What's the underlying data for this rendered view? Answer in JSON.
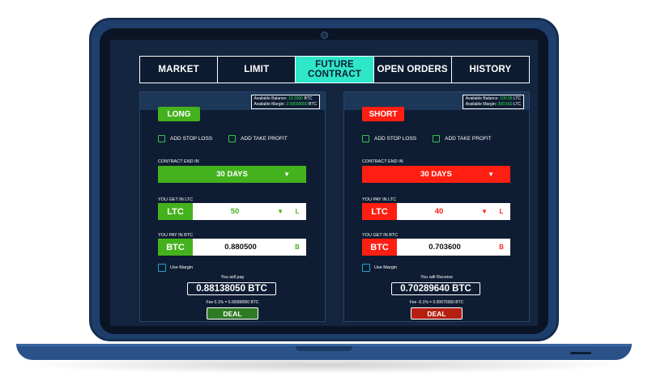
{
  "colors": {
    "long_green": "#44b21d",
    "short_red": "#ff1f12",
    "active_tab": "#2ee6c8",
    "deal_green": "#2f7a24",
    "deal_red": "#b41f12"
  },
  "tabs": [
    {
      "label": "MARKET"
    },
    {
      "label": "LIMIT"
    },
    {
      "label": "FUTURE CONTRACT"
    },
    {
      "label": "OPEN ORDERS"
    },
    {
      "label": "HISTORY"
    }
  ],
  "long": {
    "balance_label": "Available Balance:",
    "balance_value": "10.2000",
    "balance_unit": "BTC",
    "margin_label": "Available Margin:",
    "margin_value": "2.00500000",
    "margin_unit": "BTC",
    "side_label": "LONG",
    "stop_loss": "ADD STOP LOSS",
    "take_profit": "ADD TAKE PROFIT",
    "contract_label": "CONTRACT END IN",
    "contract_value": "30 DAYS",
    "get_label": "YOU GET IN LTC",
    "get_currency": "LTC",
    "get_amount": "50",
    "get_suffix": "L",
    "pay_label": "YOU PAY IN BTC",
    "pay_currency": "BTC",
    "pay_amount": "0.880500",
    "pay_suffix": "B",
    "use_margin": "Use Margin",
    "total_label": "You will pay",
    "total_value": "0.88138050 BTC",
    "fee": "Fee 0.1% = 0.00088050 BTC",
    "deal": "DEAL"
  },
  "short": {
    "balance_label": "Available Balance:",
    "balance_value": "100.56",
    "balance_unit": "LTC",
    "margin_label": "Available Margin:",
    "margin_value": "200.560",
    "margin_unit": "LTC",
    "side_label": "SHORT",
    "stop_loss": "ADD STOP LOSS",
    "take_profit": "ADD TAKE PROFIT",
    "contract_label": "CONTRACT END IN",
    "contract_value": "30 DAYS",
    "pay_label": "YOU PAY IN LTC",
    "pay_currency": "LTC",
    "pay_amount": "40",
    "pay_suffix": "L",
    "get_label": "YOU GET IN BTC",
    "get_currency": "BTC",
    "get_amount": "0.703600",
    "get_suffix": "B",
    "use_margin": "Use Margin",
    "total_label": "You will Receive",
    "total_value": "0.70289640 BTC",
    "fee": "Fee -0.1% = 0.00070360 BTC",
    "deal": "DEAL"
  }
}
